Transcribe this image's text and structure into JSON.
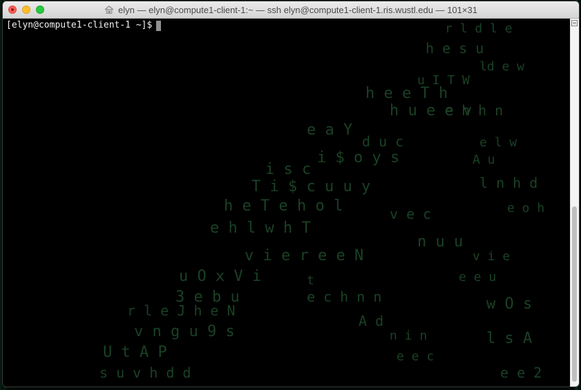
{
  "window": {
    "title": "elyn — elyn@compute1-client-1:~ — ssh elyn@compute1-client-1.ris.wustl.edu — 101×31",
    "title_icon": "home-icon",
    "traffic_lights": [
      "close",
      "minimize",
      "zoom"
    ]
  },
  "terminal": {
    "prompt": "[elyn@compute1-client-1 ~]$",
    "cursor_color": "#8f8f8f",
    "text_color": "#f2f2f2",
    "background_color": "#000000",
    "background_art": "matrix-style falling letters (faint green)"
  },
  "scrollbar": {
    "menu_icon": "scroll-menu-icon",
    "thumb_position_fraction": 0.52,
    "thumb_size_fraction": 0.48
  },
  "colors": {
    "close": "#fc5f57",
    "minimize": "#fdbc2e",
    "zoom": "#28c840",
    "matrix_green": "#2b6a3e"
  }
}
